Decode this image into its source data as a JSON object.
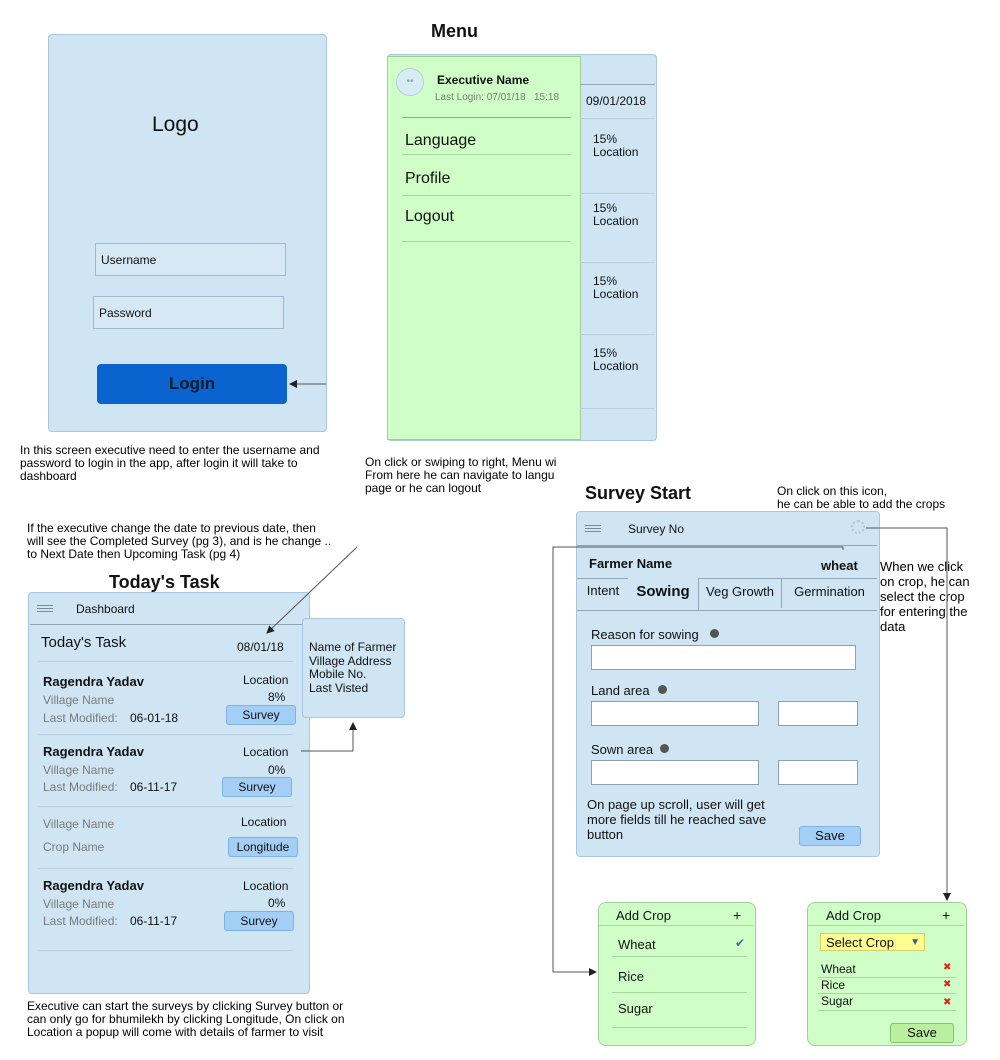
{
  "login": {
    "logo": "Logo",
    "username_placeholder": "Username",
    "password_placeholder": "Password",
    "login_button": "Login",
    "note": "In this screen executive need to enter the username and password to login in the app, after login it will take to dashboard"
  },
  "menu": {
    "title": "Menu",
    "executive_name": "Executive Name",
    "last_login": "Last Login: 07/01/18   15:18",
    "items": [
      "Language",
      "Profile",
      "Logout"
    ],
    "date": "09/01/2018",
    "cards": [
      {
        "percent": "15%",
        "location": "Location"
      },
      {
        "percent": "15%",
        "location": "Location"
      },
      {
        "percent": "15%",
        "location": "Location"
      },
      {
        "percent": "15%",
        "location": "Location"
      }
    ],
    "note_line1": "On click or swiping to right, Menu wi",
    "note_line2": "From here he can navigate to langu",
    "note_line3": "page or he can logout"
  },
  "task": {
    "note_top_line1": "If the executive change the date to previous date, then",
    "note_top_line2": "will see the Completed Survey (pg 3), and is he change ..",
    "note_top_line3": "to Next Date then Upcoming Task (pg 4)",
    "heading": "Today's Task",
    "header_title": "Dashboard",
    "title": "Today's Task",
    "date": "08/01/18",
    "rows": [
      {
        "name": "Ragendra Yadav",
        "location": "Location",
        "village": "Village Name",
        "percent": "8%",
        "modified_label": "Last Modified:",
        "modified": "06-01-18",
        "button": "Survey"
      },
      {
        "name": "Ragendra Yadav",
        "location": "Location",
        "village": "Village Name",
        "percent": "0%",
        "modified_label": "Last Modified:",
        "modified": "06-11-17",
        "button": "Survey"
      },
      {
        "village": "Village Name",
        "location": "Location",
        "crop": "Crop Name",
        "button": "Longitude"
      },
      {
        "name": "Ragendra Yadav",
        "location": "Location",
        "village": "Village Name",
        "percent": "0%",
        "modified_label": "Last Modified:",
        "modified": "06-11-17",
        "button": "Survey"
      }
    ],
    "popup": [
      "Name of Farmer",
      "Village Address",
      "Mobile No.",
      "Last Visted"
    ],
    "note_bottom": "Executive can start the surveys by clicking Survey button or can only go for bhumilekh by clicking Longitude, On click on Location a popup will come with details of farmer to visit"
  },
  "survey": {
    "heading": "Survey Start",
    "icon_note_line1": "On click on this icon,",
    "icon_note_line2": "he can be able to add the crops",
    "header_title": "Survey No",
    "farmer_name": "Farmer Name",
    "crop": "wheat",
    "tabs": [
      "Intent",
      "Sowing",
      "Veg Growth",
      "Germination"
    ],
    "reason_label": "Reason for sowing",
    "land_area_label": "Land area",
    "sown_area_label": "Sown area",
    "scroll_note": "On page up scroll, user will get more fields till he reached save button",
    "save": "Save",
    "crop_note": "When we click on crop, he can select the crop for entering the data"
  },
  "add_crop_1": {
    "title": "Add Crop",
    "plus": "+",
    "items": [
      "Wheat",
      "Rice",
      "Sugar"
    ]
  },
  "add_crop_2": {
    "title": "Add Crop",
    "plus": "+",
    "select": "Select Crop",
    "items": [
      "Wheat",
      "Rice",
      "Sugar"
    ],
    "save": "Save"
  }
}
